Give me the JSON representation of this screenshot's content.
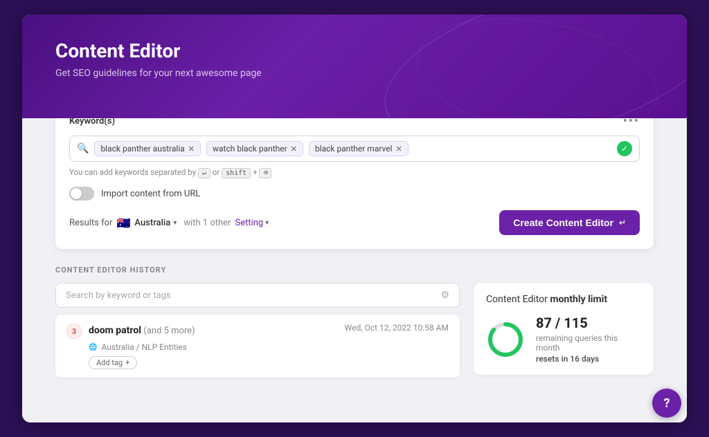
{
  "header": {
    "title": "Content Editor",
    "subtitle": "Get SEO guidelines for your next awesome page"
  },
  "keywords_card": {
    "label": "Keyword(s)",
    "dots_menu": "•••",
    "tags": [
      {
        "text": "black panther australia",
        "id": "tag-1"
      },
      {
        "text": "watch black panther",
        "id": "tag-2"
      },
      {
        "text": "black panther marvel",
        "id": "tag-3"
      }
    ],
    "hint": "You can add keywords separated by",
    "hint_key1": "↵",
    "hint_or": "or",
    "hint_key2": "shift",
    "hint_plus": "+",
    "hint_key3": "⌫",
    "toggle_label": "Import content from URL",
    "results_for": "Results for",
    "country": "Australia",
    "with_other": "with 1 other",
    "setting": "Setting",
    "create_button": "Create Content Editor"
  },
  "history": {
    "title": "CONTENT EDITOR HISTORY",
    "search_placeholder": "Search by keyword or tags",
    "item": {
      "badge": "3",
      "name": "doom patrol",
      "more": "(and 5 more)",
      "date": "Wed, Oct 12, 2022 10:58 AM",
      "meta": "Australia / NLP Entities",
      "add_tag": "Add tag"
    }
  },
  "limit": {
    "title": "Content Editor",
    "title_bold": "monthly limit",
    "used": 87,
    "total": 115,
    "display": "87 / 115",
    "desc": "remaining queries this month",
    "reset_label": "resets",
    "reset_value": "in 16 days"
  },
  "help": {
    "icon": "?"
  }
}
